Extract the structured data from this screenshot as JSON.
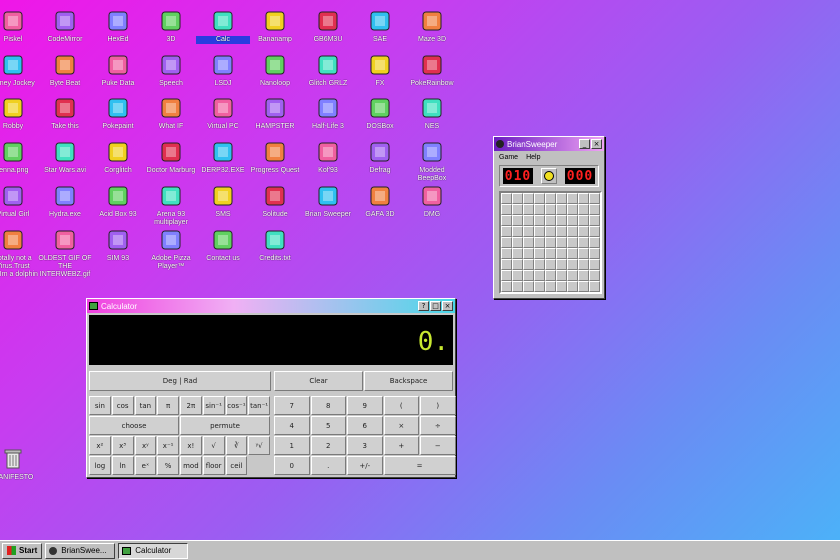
{
  "desktop": {
    "icons": [
      {
        "label": "Piskel",
        "icon": "piskel-icon"
      },
      {
        "label": "CodeMirror",
        "icon": "codemirror-icon"
      },
      {
        "label": "HexEd",
        "icon": "hexed-icon"
      },
      {
        "label": "3D",
        "icon": "teapot-icon"
      },
      {
        "label": "Calc",
        "icon": "calculator-icon"
      },
      {
        "label": "Bananamp",
        "icon": "banana-icon"
      },
      {
        "label": "GB6M3U",
        "icon": "gb-icon"
      },
      {
        "label": "SAE",
        "icon": "amiga-ball-icon"
      },
      {
        "label": "Maze 3D",
        "icon": "maze-icon"
      },
      {
        "label": "Poney Jockey",
        "icon": "pony-icon"
      },
      {
        "label": "Byte Beat",
        "icon": "bytebeat-icon"
      },
      {
        "label": "Puke Data",
        "icon": "pukedata-icon"
      },
      {
        "label": "Speech",
        "icon": "speech-icon"
      },
      {
        "label": "LSDJ",
        "icon": "lsdj-icon"
      },
      {
        "label": "Nanoloop",
        "icon": "nanoloop-icon"
      },
      {
        "label": "Glitch GRLZ",
        "icon": "lips-icon"
      },
      {
        "label": "FX",
        "icon": "fx-icon"
      },
      {
        "label": "PokeRainbow",
        "icon": "pokerainbow-icon"
      },
      {
        "label": "Robby",
        "icon": "robby-icon"
      },
      {
        "label": "Take this",
        "icon": "takethis-icon"
      },
      {
        "label": "Pokepaint",
        "icon": "pokepaint-icon"
      },
      {
        "label": "What IF",
        "icon": "whatif-icon"
      },
      {
        "label": "Virtual PC",
        "icon": "virtualpc-icon"
      },
      {
        "label": "HAMPSTER",
        "icon": "hamster-icon"
      },
      {
        "label": "Half-Life 3",
        "icon": "halflife-icon"
      },
      {
        "label": "DOSBox",
        "icon": "dosbox-icon"
      },
      {
        "label": "NES",
        "icon": "nes-icon"
      },
      {
        "label": "jenna.png",
        "icon": "image-icon"
      },
      {
        "label": "Star Wars.avi",
        "icon": "yoda-icon"
      },
      {
        "label": "Corglitch",
        "icon": "corgi-icon"
      },
      {
        "label": "Doctor Marburg",
        "icon": "doctor-icon"
      },
      {
        "label": "DERP32.EXE",
        "icon": "computer-icon"
      },
      {
        "label": "Progress Quest",
        "icon": "progressquest-icon"
      },
      {
        "label": "Kof'93",
        "icon": "kof-icon"
      },
      {
        "label": "Defrag",
        "icon": "defrag-icon"
      },
      {
        "label": "Modded BeepBox",
        "icon": "beepbox-icon"
      },
      {
        "label": "Virtual Girl",
        "icon": "virtualgirl-icon"
      },
      {
        "label": "Hydra.exe",
        "icon": "hydra-icon"
      },
      {
        "label": "Acid Box 93",
        "icon": "smiley-icon"
      },
      {
        "label": "Arena 93 multiplayer",
        "icon": "cube-icon"
      },
      {
        "label": "SMS",
        "icon": "sms-icon"
      },
      {
        "label": "Solitude",
        "icon": "solitude-icon"
      },
      {
        "label": "Brian Sweeper",
        "icon": "mine-icon"
      },
      {
        "label": "GAFA 3D",
        "icon": "gafa-icon"
      },
      {
        "label": "DMG",
        "icon": "dmg-icon"
      },
      {
        "label": "Totally not a Virus.Trust me.Im a dolphin",
        "icon": "dolphin-icon"
      },
      {
        "label": "OLDEST GIF OF THE INTERWEBZ.gif",
        "icon": "gif-icon"
      },
      {
        "label": "SIM 93",
        "icon": "sim-icon"
      },
      {
        "label": "Adobe Pizza Player™",
        "icon": "pizza-icon"
      },
      {
        "label": "Contact us",
        "icon": "contact-icon"
      },
      {
        "label": "Credits.txt",
        "icon": "text-file-icon"
      },
      {
        "label": "MANIFESTO",
        "icon": "question-icon"
      },
      {
        "label": "TRASH",
        "icon": "trash-icon"
      }
    ]
  },
  "sweeper": {
    "title": "BrianSweeper",
    "menu": [
      "Game",
      "Help"
    ],
    "mines": "010",
    "time": "000"
  },
  "calculator": {
    "title": "Calculator",
    "display": "0.",
    "mode": "Deg | Rad",
    "clear": "Clear",
    "backspace": "Backspace",
    "sci_rows": [
      [
        "sin",
        "cos",
        "tan",
        "π",
        "2π",
        "sin⁻¹",
        "cos⁻¹",
        "tan⁻¹"
      ],
      [
        "choose",
        "permute"
      ],
      [
        "x²",
        "x³",
        "xʸ",
        "x⁻¹",
        "x!",
        "√",
        "∛",
        "ʸ√"
      ],
      [
        "log",
        "ln",
        "eˣ",
        "%",
        "mod",
        "floor",
        "ceil"
      ]
    ],
    "num_rows": [
      [
        "7",
        "8",
        "9",
        "(",
        ")"
      ],
      [
        "4",
        "5",
        "6",
        "×",
        "÷"
      ],
      [
        "1",
        "2",
        "3",
        "+",
        "−"
      ],
      [
        "0",
        ".",
        "+/-",
        "="
      ]
    ]
  },
  "taskbar": {
    "start": "Start",
    "tasks": [
      "BrianSwee...",
      "Calculator"
    ]
  },
  "colors": {
    "title_from": "#7a1cc8",
    "title_to": "#f4a0f0",
    "calc_title_to": "#48d8e8",
    "lcd_text": "#c8e830"
  }
}
